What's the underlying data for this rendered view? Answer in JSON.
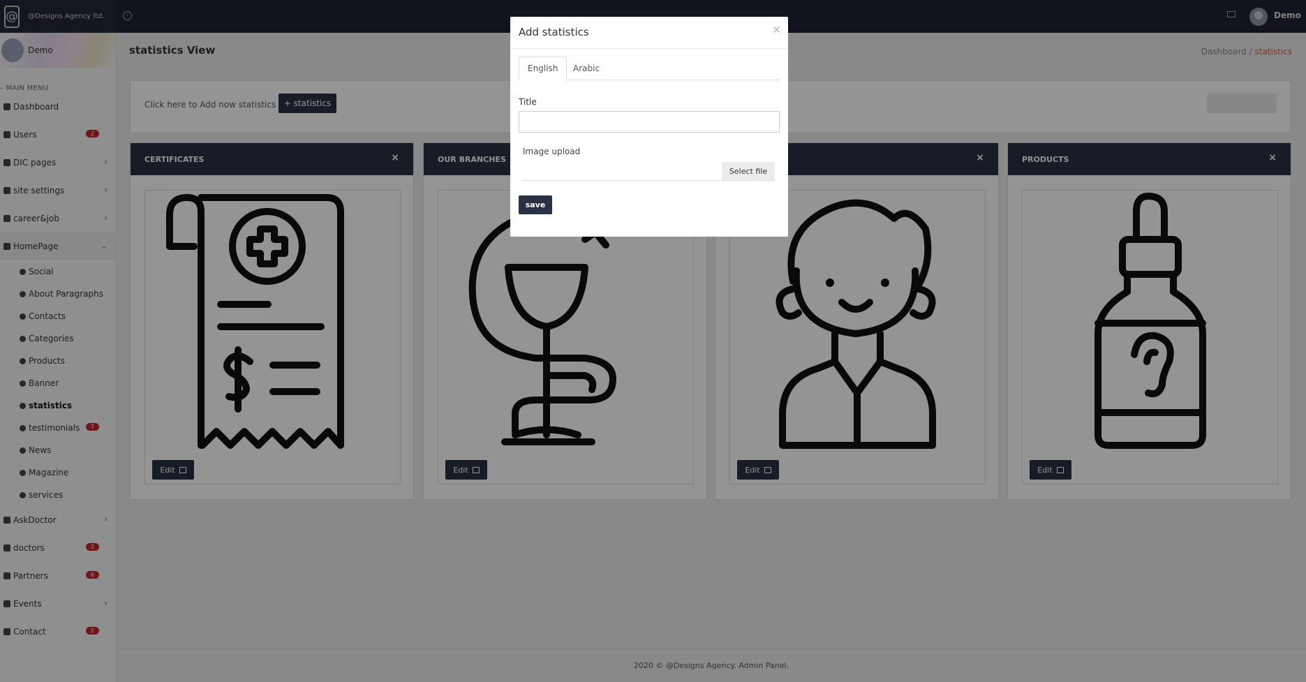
{
  "brand": {
    "name": "@Designs Agency ltd.",
    "logo_glyph": "@"
  },
  "topbar": {
    "user_name": "Demo"
  },
  "sidebar": {
    "user_name": "Demo",
    "menu_heading": "– MAIN MENU",
    "items": [
      {
        "label": "Dashboard",
        "icon": "list-icon"
      },
      {
        "label": "Users",
        "icon": "users-icon",
        "badge": "2"
      },
      {
        "label": "DIC pages",
        "icon": "page-icon",
        "arrow": "›"
      },
      {
        "label": "site settings",
        "icon": "circle-icon",
        "arrow": "›"
      },
      {
        "label": "career&job",
        "icon": "tag-icon",
        "arrow": "›"
      },
      {
        "label": "HomePage",
        "icon": "tag-icon",
        "arrow": "⌄"
      }
    ],
    "sub_items": [
      {
        "label": "Social",
        "icon": "link-icon"
      },
      {
        "label": "About Paragraphs",
        "icon": "circle-icon"
      },
      {
        "label": "Contacts",
        "icon": "circle-icon"
      },
      {
        "label": "Categories",
        "icon": "tag-icon"
      },
      {
        "label": "Products",
        "icon": "product-icon"
      },
      {
        "label": "Banner",
        "icon": "image-icon"
      },
      {
        "label": "statistics",
        "icon": "tag-icon"
      },
      {
        "label": "testimonials",
        "icon": "circle-icon",
        "badge": "7"
      },
      {
        "label": "News",
        "icon": "news-icon"
      },
      {
        "label": "Magazine",
        "icon": "news-icon"
      },
      {
        "label": "services",
        "icon": "info-icon"
      }
    ],
    "items_after": [
      {
        "label": "AskDoctor",
        "icon": "tag-icon",
        "arrow": "›"
      },
      {
        "label": "doctors",
        "icon": "circle-icon",
        "badge": "2"
      },
      {
        "label": "Partners",
        "icon": "users-icon",
        "badge": "6"
      },
      {
        "label": "Events",
        "icon": "info-icon",
        "arrow": "›"
      },
      {
        "label": "Contact",
        "icon": "mail-icon",
        "badge": "2"
      }
    ]
  },
  "page": {
    "title": "statistics View",
    "breadcrumb": [
      "Dashboard",
      "/",
      "statistics"
    ],
    "add_text": "Click here to Add now statistics",
    "add_button": "+ statistics"
  },
  "cards": [
    {
      "title": "CERTIFICATES",
      "icon": "receipt-medical-icon",
      "edit_label": "Edit",
      "close": "×"
    },
    {
      "title": "OUR BRANCHES",
      "icon": "pharmacy-cup-snake-icon",
      "edit_label": "Edit",
      "close": "×"
    },
    {
      "title": "",
      "icon": "doctor-person-icon",
      "edit_label": "Edit",
      "close": "×"
    },
    {
      "title": "PRODUCTS",
      "icon": "ear-drops-bottle-icon",
      "edit_label": "Edit",
      "close": "×"
    }
  ],
  "footer": "2020 © @Designs Agency. Admin Panel.",
  "modal": {
    "title": "Add statistics",
    "close": "×",
    "tabs": [
      "English",
      "Arabic"
    ],
    "title_label": "Title",
    "title_value": "",
    "image_label": "Image upload",
    "select_file": "Select file",
    "save": "save"
  }
}
